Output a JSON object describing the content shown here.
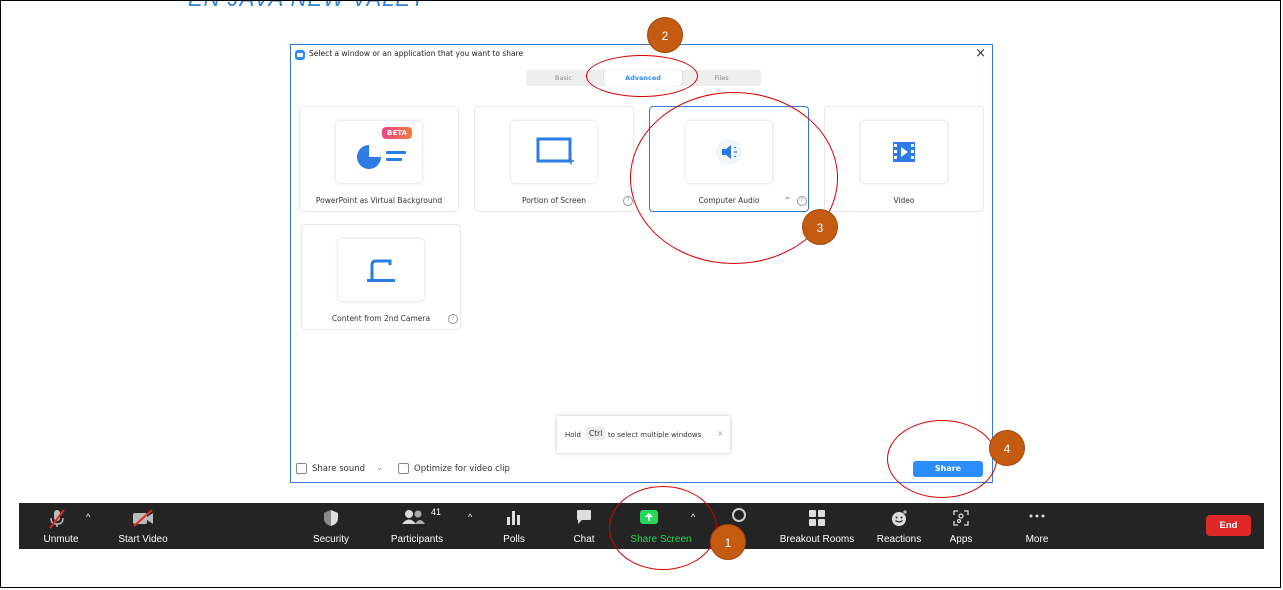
{
  "slide": {
    "title": "EN JAVA NEW VALET"
  },
  "dialog": {
    "title": "Select a window or an application that you want to share",
    "close_glyph": "×",
    "tabs": [
      {
        "label": "Basic"
      },
      {
        "label": "Advanced",
        "active": true
      },
      {
        "label": "Files"
      }
    ],
    "cards": [
      {
        "label": "PowerPoint as Virtual Background",
        "badge": "BETA",
        "icon": "powerpoint-background-icon"
      },
      {
        "label": "Portion of Screen",
        "icon": "portion-of-screen-icon",
        "help": "?"
      },
      {
        "label": "Computer Audio",
        "icon": "speaker-icon",
        "dropdown": "⌄",
        "help": "?",
        "selected": true
      },
      {
        "label": "Video",
        "icon": "video-file-icon"
      },
      {
        "label": "Content from 2nd Camera",
        "icon": "document-camera-icon",
        "help": "?"
      }
    ],
    "tooltip": {
      "hold": "Hold",
      "key": "Ctrl",
      "rest": "to select multiple windows",
      "close": "×"
    },
    "share_sound": {
      "label": "Share sound",
      "checked": false,
      "dropdown": "⌄"
    },
    "optimize_video": {
      "label": "Optimize for video clip",
      "checked": false
    },
    "share_button": "Share"
  },
  "toolbar": {
    "unmute": "Unmute",
    "start_video": "Start Video",
    "security": "Security",
    "participants": "Participants",
    "participants_count": "41",
    "polls": "Polls",
    "chat": "Chat",
    "share_screen": "Share Screen",
    "breakout_rooms": "Breakout Rooms",
    "reactions": "Reactions",
    "apps": "Apps",
    "more": "More",
    "end": "End",
    "caret": "^",
    "colors": {
      "background": "#242424",
      "share_green": "#23d959",
      "end_red": "#e02828"
    }
  },
  "annotations": {
    "badges": [
      "1",
      "2",
      "3",
      "4"
    ],
    "badge_color": "#c55a11",
    "ellipse_color": "#d40000"
  },
  "colors": {
    "accent": "#2d8cff"
  }
}
